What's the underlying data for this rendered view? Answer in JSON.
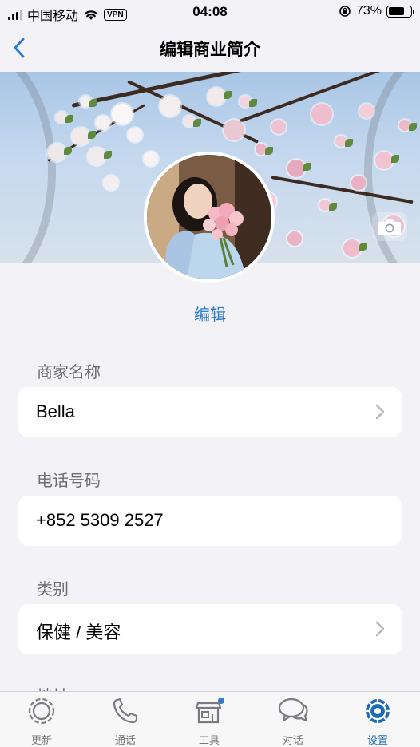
{
  "status_bar": {
    "carrier": "中国移动",
    "vpn": "VPN",
    "time": "04:08",
    "battery": "73%",
    "battery_level": 0.73
  },
  "nav": {
    "title": "编辑商业简介",
    "back_icon": "chevron-left-icon"
  },
  "profile": {
    "edit_label": "编辑",
    "camera_icon": "camera-icon"
  },
  "fields": [
    {
      "label": "商家名称",
      "value": "Bella",
      "has_chevron": true
    },
    {
      "label": "电话号码",
      "value": "+852 5309 2527",
      "has_chevron": false
    },
    {
      "label": "类别",
      "value": "保健 / 美容",
      "has_chevron": true
    },
    {
      "label": "地址",
      "value": "",
      "has_chevron": false
    }
  ],
  "tabs": [
    {
      "label": "更新",
      "icon": "status-icon",
      "active": false
    },
    {
      "label": "通话",
      "icon": "phone-icon",
      "active": false
    },
    {
      "label": "工具",
      "icon": "store-icon",
      "active": false,
      "badge": true
    },
    {
      "label": "对话",
      "icon": "chat-bubbles-icon",
      "active": false
    },
    {
      "label": "设置",
      "icon": "gear-icon",
      "active": true
    }
  ],
  "colors": {
    "accent": "#2f7bc6",
    "active_tab": "#1c6cb4",
    "background": "#f2f2f7"
  }
}
